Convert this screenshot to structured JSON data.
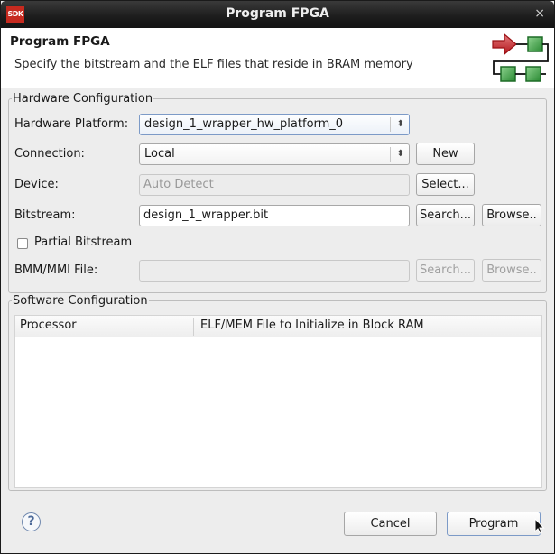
{
  "window": {
    "title": "Program FPGA",
    "app_icon_label": "SDK",
    "close_glyph": "×"
  },
  "header": {
    "title": "Program FPGA",
    "description": "Specify the bitstream and the ELF files that reside in BRAM memory"
  },
  "hardware": {
    "legend": "Hardware Configuration",
    "platform": {
      "label": "Hardware Platform:",
      "value": "design_1_wrapper_hw_platform_0"
    },
    "connection": {
      "label": "Connection:",
      "value": "Local",
      "new_label": "New"
    },
    "device": {
      "label": "Device:",
      "placeholder": "Auto Detect",
      "select_label": "Select..."
    },
    "bitstream": {
      "label": "Bitstream:",
      "value": "design_1_wrapper.bit",
      "search_label": "Search...",
      "browse_label": "Browse.."
    },
    "partial": {
      "label": "Partial Bitstream",
      "checked": false
    },
    "bmm": {
      "label": "BMM/MMI File:",
      "value": "",
      "search_label": "Search...",
      "browse_label": "Browse.."
    }
  },
  "software": {
    "legend": "Software Configuration",
    "columns": [
      "Processor",
      "ELF/MEM File to Initialize in Block RAM"
    ],
    "rows": []
  },
  "footer": {
    "help_glyph": "?",
    "cancel_label": "Cancel",
    "program_label": "Program"
  },
  "colors": {
    "arrow_red": "#c0262b",
    "block_green": "#2f9a3a",
    "focus_blue": "#7c9ac7"
  }
}
